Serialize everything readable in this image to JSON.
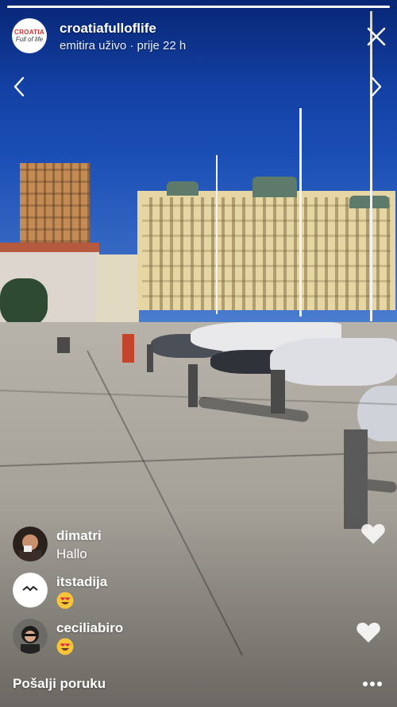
{
  "header": {
    "avatar_line1": "CROATIA",
    "avatar_line2": "Full of life",
    "username": "croatiafulloflife",
    "status": "emitira uživo · prije 22 h",
    "progress_fraction": 1.0
  },
  "comments": [
    {
      "name": "dimatri",
      "text": "Hallo",
      "emoji": null
    },
    {
      "name": "itstadija",
      "text": "",
      "emoji": "heart-eyes"
    },
    {
      "name": "ceciliabiro",
      "text": "",
      "emoji": "heart-eyes"
    }
  ],
  "composer": {
    "placeholder": "Pošalji poruku"
  },
  "colors": {
    "accent_red": "#d62e2e",
    "text": "#ffffff"
  }
}
